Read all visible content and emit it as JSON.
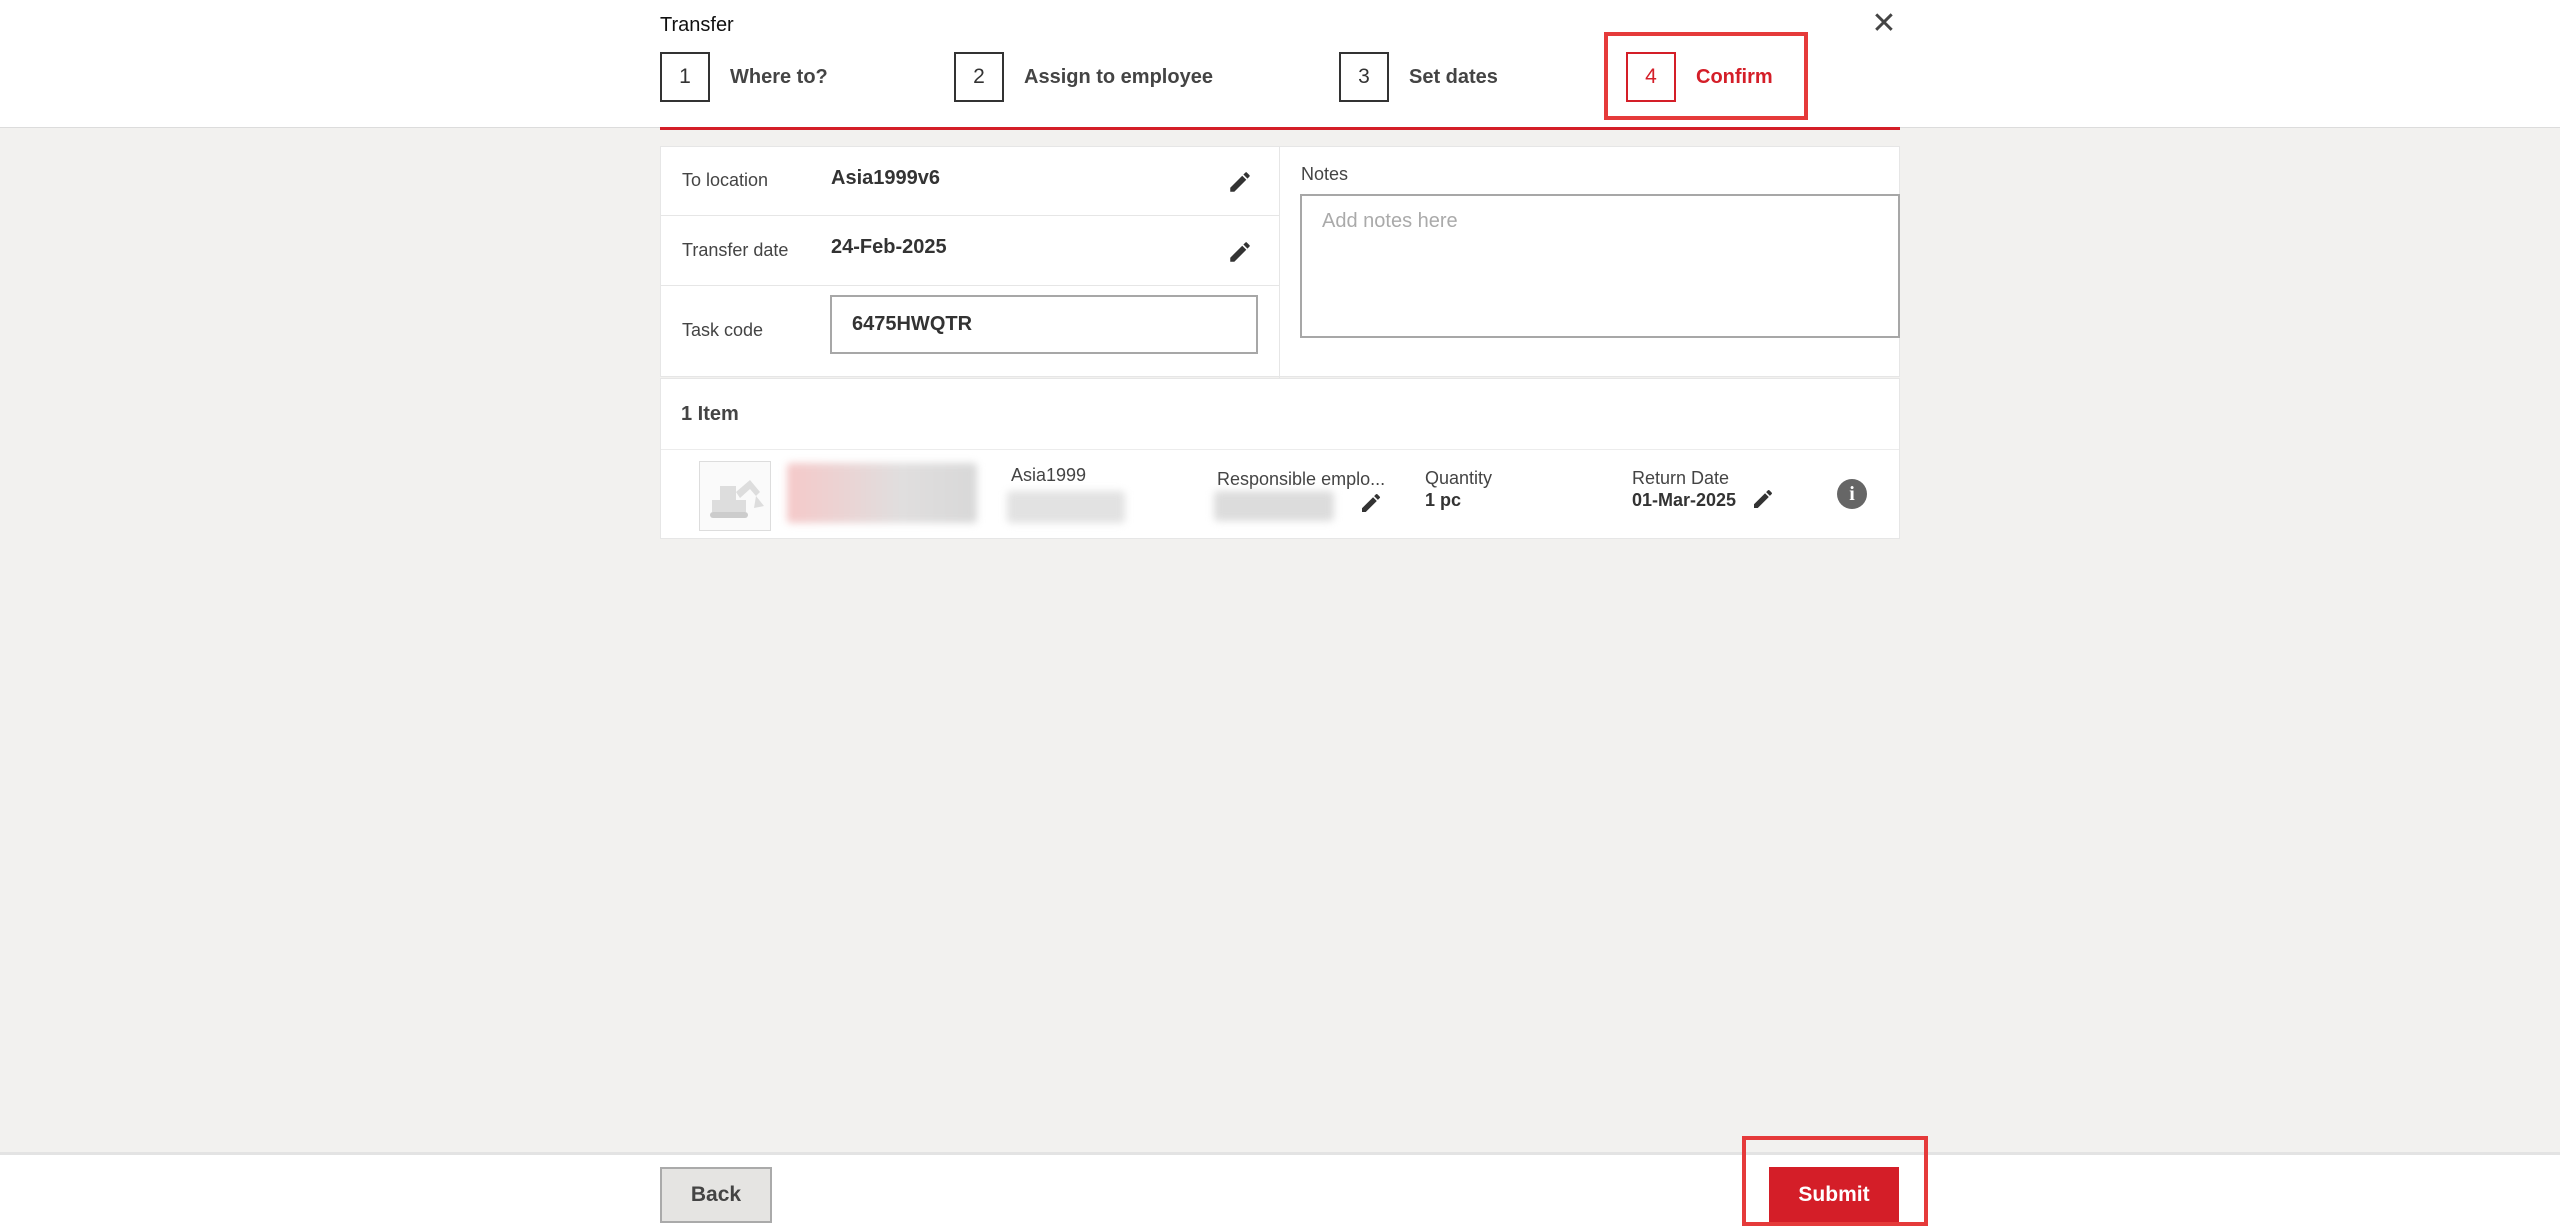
{
  "dialog": {
    "title": "Transfer"
  },
  "steps": [
    {
      "num": "1",
      "label": "Where to?"
    },
    {
      "num": "2",
      "label": "Assign to employee"
    },
    {
      "num": "3",
      "label": "Set dates"
    },
    {
      "num": "4",
      "label": "Confirm",
      "active": true
    }
  ],
  "summary": {
    "to_location_label": "To location",
    "to_location_value": "Asia1999v6",
    "transfer_date_label": "Transfer date",
    "transfer_date_value": "24-Feb-2025",
    "task_code_label": "Task code",
    "task_code_value": "6475HWQTR"
  },
  "notes": {
    "label": "Notes",
    "placeholder": "Add notes here",
    "value": ""
  },
  "items": {
    "count_label": "1 Item",
    "list": [
      {
        "name": "Asia1999",
        "responsible_label": "Responsible emplo...",
        "quantity_label": "Quantity",
        "quantity_value": "1 pc",
        "return_date_label": "Return Date",
        "return_date_value": "01-Mar-2025"
      }
    ]
  },
  "footer": {
    "back_label": "Back",
    "submit_label": "Submit"
  },
  "colors": {
    "accent": "#d41e28",
    "highlight": "#e53a3a",
    "background": "#f2f1ef"
  },
  "icons": {
    "close": "close-icon",
    "edit": "pencil-icon",
    "info": "info-icon",
    "item": "excavator-icon"
  }
}
